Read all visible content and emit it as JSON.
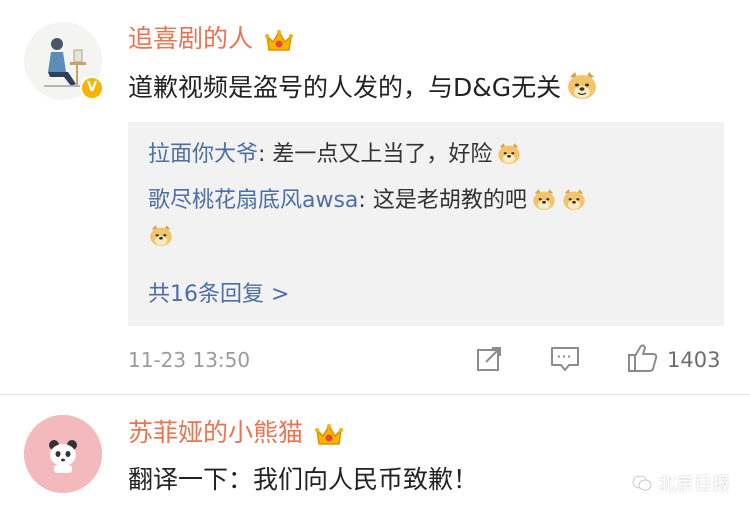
{
  "comment1": {
    "username": "追喜剧的人",
    "text": "道歉视频是盗号的人发的，与D&G无关",
    "replies": [
      {
        "user": "拉面你大爷",
        "text": ": 差一点又上当了，好险"
      },
      {
        "user": "歌尽桃花扇底风awsa",
        "text": ": 这是老胡教的吧"
      }
    ],
    "more_replies": "共16条回复 >",
    "time": "11-23 13:50",
    "likes": "1403"
  },
  "comment2": {
    "username": "苏菲娅的小熊猫",
    "text": "翻译一下：我们向人民币致歉！"
  },
  "watermark": "北京日报",
  "colors": {
    "username": "#eb7350",
    "reply_user": "#4d6fa3",
    "reply_bg": "#f2f2f2",
    "badge": "#f7b500"
  }
}
